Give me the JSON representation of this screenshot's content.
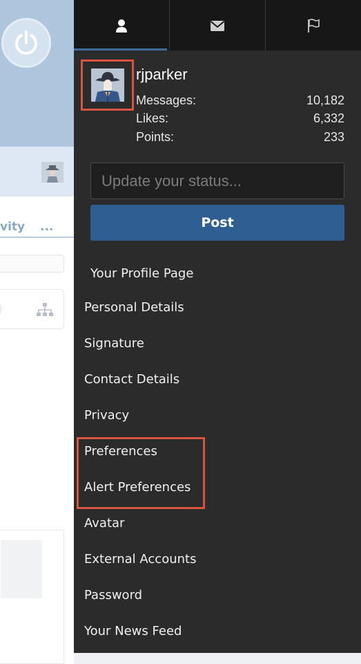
{
  "background": {
    "tab_partial_1": "vity",
    "tab_partial_2": "..."
  },
  "tabs": [
    {
      "icon": "user-icon",
      "active": true
    },
    {
      "icon": "envelope-icon",
      "active": false
    },
    {
      "icon": "flag-icon",
      "active": false
    }
  ],
  "profile": {
    "username": "rjparker",
    "stats": [
      {
        "label": "Messages:",
        "value": "10,182"
      },
      {
        "label": "Likes:",
        "value": "6,332"
      },
      {
        "label": "Points:",
        "value": "233"
      }
    ]
  },
  "status": {
    "placeholder": "Update your status...",
    "post_label": "Post"
  },
  "menu": {
    "items": [
      "Your Profile Page",
      "Personal Details",
      "Signature",
      "Contact Details",
      "Privacy",
      "Preferences",
      "Alert Preferences",
      "Avatar",
      "External Accounts",
      "Password",
      "Your News Feed"
    ]
  },
  "colors": {
    "menu_bg": "#2b2b2b",
    "tab_bar_bg": "#171717",
    "accent": "#2f5f92",
    "highlight": "#d9533f",
    "header_bg": "#adc6de"
  }
}
